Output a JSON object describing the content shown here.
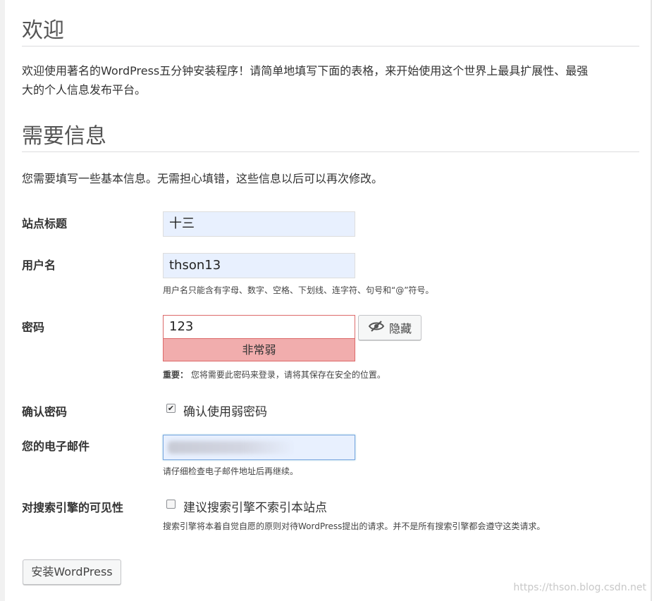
{
  "welcome": {
    "title": "欢迎",
    "line1": "欢迎使用著名的WordPress五分钟安装程序！请简单地填写下面的表格，来开始使用这个世界上最具扩展性、最强",
    "line2": "大的个人信息发布平台。"
  },
  "info": {
    "title": "需要信息",
    "description": "您需要填写一些基本信息。无需担心填错，这些信息以后可以再次修改。"
  },
  "form": {
    "site_title": {
      "label": "站点标题",
      "value": "十三"
    },
    "username": {
      "label": "用户名",
      "value": "thson13",
      "hint": "用户名只能含有字母、数字、空格、下划线、连字符、句号和“@”符号。"
    },
    "password": {
      "label": "密码",
      "value": "123",
      "strength": "非常弱",
      "hide_label": "隐藏",
      "hint_bold": "重要：",
      "hint": "您将需要此密码来登录，请将其保存在安全的位置。"
    },
    "confirm_password": {
      "label": "确认密码",
      "checkbox_label": "确认使用弱密码",
      "checked": true
    },
    "email": {
      "label": "您的电子邮件",
      "hint": "请仔细检查电子邮件地址后再继续。"
    },
    "visibility": {
      "label": "对搜索引擎的可见性",
      "checkbox_label": "建议搜索引擎不索引本站点",
      "checked": false,
      "hint": "搜索引擎将本着自觉自愿的原则对待WordPress提出的请求。并不是所有搜索引擎都会遵守这类请求。"
    }
  },
  "install_button": "安装WordPress",
  "watermark": "https://thson.blog.csdn.net",
  "icons": {
    "hide": "eye-slash-icon",
    "check": "checkmark-icon"
  }
}
